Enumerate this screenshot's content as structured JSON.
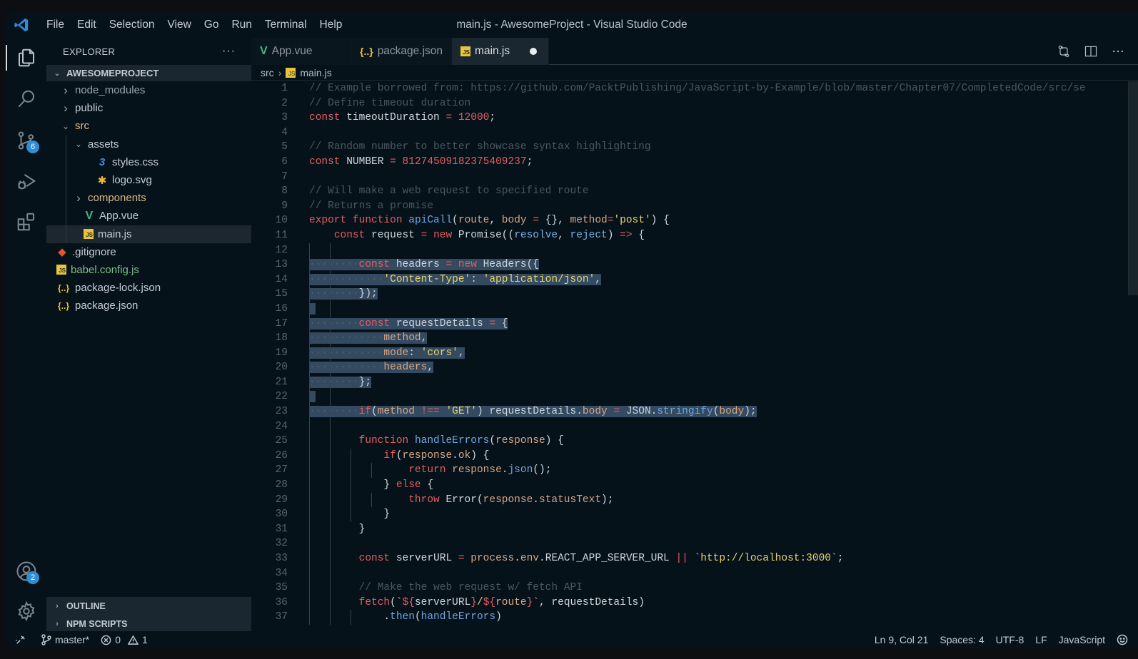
{
  "window": {
    "title": "main.js - AwesomeProject - Visual Studio Code"
  },
  "menu": [
    "File",
    "Edit",
    "Selection",
    "View",
    "Go",
    "Run",
    "Terminal",
    "Help"
  ],
  "activity_bar": {
    "items": [
      {
        "name": "explorer",
        "icon": "files-icon",
        "active": true
      },
      {
        "name": "search",
        "icon": "search-icon"
      },
      {
        "name": "source-control",
        "icon": "source-control-icon",
        "badge": "6"
      },
      {
        "name": "run-debug",
        "icon": "run-debug-icon"
      },
      {
        "name": "extensions",
        "icon": "extensions-icon"
      }
    ],
    "bottom": [
      {
        "name": "accounts",
        "icon": "account-icon",
        "badge": "2"
      },
      {
        "name": "manage",
        "icon": "gear-icon"
      }
    ]
  },
  "sidebar": {
    "title": "EXPLORER",
    "more": "···",
    "project": "AWESOMEPROJECT",
    "tree": [
      {
        "label": "node_modules",
        "type": "folder",
        "depth": 0,
        "expanded": false,
        "style": "ignored"
      },
      {
        "label": "public",
        "type": "folder",
        "depth": 0,
        "expanded": false
      },
      {
        "label": "src",
        "type": "folder",
        "depth": 0,
        "expanded": true,
        "style": "folder-color"
      },
      {
        "label": "assets",
        "type": "folder",
        "depth": 1,
        "expanded": true
      },
      {
        "label": "styles.css",
        "type": "css",
        "depth": 2
      },
      {
        "label": "logo.svg",
        "type": "svg",
        "depth": 2
      },
      {
        "label": "components",
        "type": "folder",
        "depth": 1,
        "expanded": false,
        "style": "folder-color"
      },
      {
        "label": "App.vue",
        "type": "vue",
        "depth": 1
      },
      {
        "label": "main.js",
        "type": "js",
        "depth": 1,
        "selected": true
      },
      {
        "label": ".gitignore",
        "type": "git",
        "depth": 0
      },
      {
        "label": "babel.config.js",
        "type": "js",
        "depth": 0,
        "style": "modified"
      },
      {
        "label": "package-lock.json",
        "type": "json",
        "depth": 0
      },
      {
        "label": "package.json",
        "type": "json",
        "depth": 0
      }
    ],
    "sections": [
      "OUTLINE",
      "NPM SCRIPTS"
    ]
  },
  "tabs": [
    {
      "label": "App.vue",
      "icon": "vue-icon",
      "active": false
    },
    {
      "label": "package.json",
      "icon": "json-icon",
      "active": false
    },
    {
      "label": "main.js",
      "icon": "js-icon",
      "active": true,
      "dirty": true
    }
  ],
  "tab_actions": [
    "compare-changes-icon",
    "split-editor-icon",
    "more-actions-icon"
  ],
  "breadcrumb": [
    "src",
    "main.js"
  ],
  "code": {
    "lines": [
      [
        [
          "c-com",
          "// Example borrowed from: https://github.com/PacktPublishing/JavaScript-by-Example/blob/master/Chapter07/CompletedCode/src/se"
        ]
      ],
      [
        [
          "c-com",
          "// Define timeout duration"
        ]
      ],
      [
        [
          "c-kw",
          "const"
        ],
        [
          "c-plain",
          " timeoutDuration "
        ],
        [
          "c-op",
          "="
        ],
        [
          "c-plain",
          " "
        ],
        [
          "c-num",
          "12000"
        ],
        [
          "c-plain",
          ";"
        ]
      ],
      [],
      [
        [
          "c-com",
          "// Random number to better showcase syntax highlighting"
        ]
      ],
      [
        [
          "c-kw",
          "const"
        ],
        [
          "c-plain",
          " NUMBER "
        ],
        [
          "c-op",
          "="
        ],
        [
          "c-plain",
          " "
        ],
        [
          "c-num",
          "81274509182375409237"
        ],
        [
          "c-plain",
          ";"
        ]
      ],
      [],
      [
        [
          "c-com",
          "// Will make a web request to specified route"
        ]
      ],
      [
        [
          "c-com",
          "// Returns a promise"
        ]
      ],
      [
        [
          "c-kw",
          "export"
        ],
        [
          "c-plain",
          " "
        ],
        [
          "c-kw",
          "function"
        ],
        [
          "c-plain",
          " "
        ],
        [
          "c-fn",
          "apiCall"
        ],
        [
          "c-plain",
          "("
        ],
        [
          "c-var",
          "route"
        ],
        [
          "c-plain",
          ", "
        ],
        [
          "c-var",
          "body"
        ],
        [
          "c-plain",
          " "
        ],
        [
          "c-op",
          "="
        ],
        [
          "c-plain",
          " {}, "
        ],
        [
          "c-var",
          "method"
        ],
        [
          "c-op",
          "="
        ],
        [
          "c-str",
          "'post'"
        ],
        [
          "c-plain",
          ") {"
        ]
      ],
      [
        [
          "c-plain",
          "    "
        ],
        [
          "c-kw",
          "const"
        ],
        [
          "c-plain",
          " request "
        ],
        [
          "c-op",
          "="
        ],
        [
          "c-plain",
          " "
        ],
        [
          "c-kw",
          "new"
        ],
        [
          "c-plain",
          " Promise(("
        ],
        [
          "c-param",
          "resolve"
        ],
        [
          "c-plain",
          ", "
        ],
        [
          "c-param",
          "reject"
        ],
        [
          "c-plain",
          ") "
        ],
        [
          "c-op",
          "=>"
        ],
        [
          "c-plain",
          " {"
        ]
      ],
      [],
      [
        [
          "ws",
          "········"
        ],
        [
          "c-kw",
          "const"
        ],
        [
          "c-plain",
          " headers "
        ],
        [
          "c-op",
          "="
        ],
        [
          "c-plain",
          " "
        ],
        [
          "c-kw",
          "new"
        ],
        [
          "c-plain",
          " Headers({"
        ]
      ],
      [
        [
          "ws",
          "············"
        ],
        [
          "c-str",
          "'Content-Type'"
        ],
        [
          "c-plain",
          ": "
        ],
        [
          "c-str",
          "'application/json'"
        ],
        [
          "c-plain",
          ","
        ]
      ],
      [
        [
          "ws",
          "········"
        ],
        [
          "c-plain",
          "});"
        ]
      ],
      [],
      [
        [
          "ws",
          "········"
        ],
        [
          "c-kw",
          "const"
        ],
        [
          "c-plain",
          " requestDetails "
        ],
        [
          "c-op",
          "="
        ],
        [
          "c-plain",
          " {"
        ]
      ],
      [
        [
          "ws",
          "············"
        ],
        [
          "c-var",
          "method"
        ],
        [
          "c-plain",
          ","
        ]
      ],
      [
        [
          "ws",
          "············"
        ],
        [
          "c-var",
          "mode"
        ],
        [
          "c-plain",
          ": "
        ],
        [
          "c-str",
          "'cors'"
        ],
        [
          "c-plain",
          ","
        ]
      ],
      [
        [
          "ws",
          "············"
        ],
        [
          "c-var",
          "headers"
        ],
        [
          "c-plain",
          ","
        ]
      ],
      [
        [
          "ws",
          "········"
        ],
        [
          "c-plain",
          "};"
        ]
      ],
      [],
      [
        [
          "ws",
          "········"
        ],
        [
          "c-kw",
          "if"
        ],
        [
          "c-plain",
          "("
        ],
        [
          "c-var",
          "method"
        ],
        [
          "c-plain",
          " "
        ],
        [
          "c-op",
          "!=="
        ],
        [
          "c-plain",
          " "
        ],
        [
          "c-str",
          "'GET'"
        ],
        [
          "c-plain",
          ") requestDetails."
        ],
        [
          "c-var",
          "body"
        ],
        [
          "c-plain",
          " "
        ],
        [
          "c-op",
          "="
        ],
        [
          "c-plain",
          " JSON."
        ],
        [
          "c-fn",
          "stringify"
        ],
        [
          "c-plain",
          "("
        ],
        [
          "c-var",
          "body"
        ],
        [
          "c-plain",
          ");"
        ]
      ],
      [],
      [
        [
          "c-plain",
          "        "
        ],
        [
          "c-kw",
          "function"
        ],
        [
          "c-plain",
          " "
        ],
        [
          "c-fn",
          "handleErrors"
        ],
        [
          "c-plain",
          "("
        ],
        [
          "c-var",
          "response"
        ],
        [
          "c-plain",
          ") {"
        ]
      ],
      [
        [
          "c-plain",
          "            "
        ],
        [
          "c-kw",
          "if"
        ],
        [
          "c-plain",
          "("
        ],
        [
          "c-var",
          "response"
        ],
        [
          "c-plain",
          "."
        ],
        [
          "c-var",
          "ok"
        ],
        [
          "c-plain",
          ") {"
        ]
      ],
      [
        [
          "c-plain",
          "                "
        ],
        [
          "c-kw",
          "return"
        ],
        [
          "c-plain",
          " "
        ],
        [
          "c-var",
          "response"
        ],
        [
          "c-plain",
          "."
        ],
        [
          "c-fn",
          "json"
        ],
        [
          "c-plain",
          "();"
        ]
      ],
      [
        [
          "c-plain",
          "            } "
        ],
        [
          "c-kw",
          "else"
        ],
        [
          "c-plain",
          " {"
        ]
      ],
      [
        [
          "c-plain",
          "                "
        ],
        [
          "c-kw",
          "throw"
        ],
        [
          "c-plain",
          " Error("
        ],
        [
          "c-var",
          "response"
        ],
        [
          "c-plain",
          "."
        ],
        [
          "c-var",
          "statusText"
        ],
        [
          "c-plain",
          ");"
        ]
      ],
      [
        [
          "c-plain",
          "            }"
        ]
      ],
      [
        [
          "c-plain",
          "        }"
        ]
      ],
      [],
      [
        [
          "c-plain",
          "        "
        ],
        [
          "c-kw",
          "const"
        ],
        [
          "c-plain",
          " serverURL "
        ],
        [
          "c-op",
          "="
        ],
        [
          "c-plain",
          " "
        ],
        [
          "c-var",
          "process"
        ],
        [
          "c-plain",
          "."
        ],
        [
          "c-var",
          "env"
        ],
        [
          "c-plain",
          ".REACT_APP_SERVER_URL "
        ],
        [
          "c-op",
          "||"
        ],
        [
          "c-plain",
          " "
        ],
        [
          "c-str",
          "`http://localhost:3000`"
        ],
        [
          "c-plain",
          ";"
        ]
      ],
      [],
      [
        [
          "c-plain",
          "        "
        ],
        [
          "c-com",
          "// Make the web request w/ fetch API"
        ]
      ],
      [
        [
          "c-plain",
          "        "
        ],
        [
          "c-kw",
          "fetch"
        ],
        [
          "c-plain",
          "("
        ],
        [
          "c-str",
          "`"
        ],
        [
          "c-kw",
          "${"
        ],
        [
          "c-plain",
          "serverURL"
        ],
        [
          "c-kw",
          "}"
        ],
        [
          "c-str",
          "/"
        ],
        [
          "c-kw",
          "${"
        ],
        [
          "c-var",
          "route"
        ],
        [
          "c-kw",
          "}"
        ],
        [
          "c-str",
          "`"
        ],
        [
          "c-plain",
          ", requestDetails)"
        ]
      ],
      [
        [
          "c-plain",
          "            ."
        ],
        [
          "c-fn",
          "then"
        ],
        [
          "c-plain",
          "("
        ],
        [
          "c-fn",
          "handleErrors"
        ],
        [
          "c-plain",
          ")"
        ]
      ]
    ],
    "selected_lines": [
      13,
      14,
      15,
      16,
      17,
      18,
      19,
      20,
      21,
      22,
      23
    ]
  },
  "status": {
    "remote": "remote-icon",
    "branch": "master*",
    "errors": "0",
    "warnings": "1",
    "cursor": "Ln 9, Col 21",
    "indent": "Spaces: 4",
    "encoding": "UTF-8",
    "eol": "LF",
    "language": "JavaScript",
    "feedback": "feedback-smiley-icon"
  }
}
